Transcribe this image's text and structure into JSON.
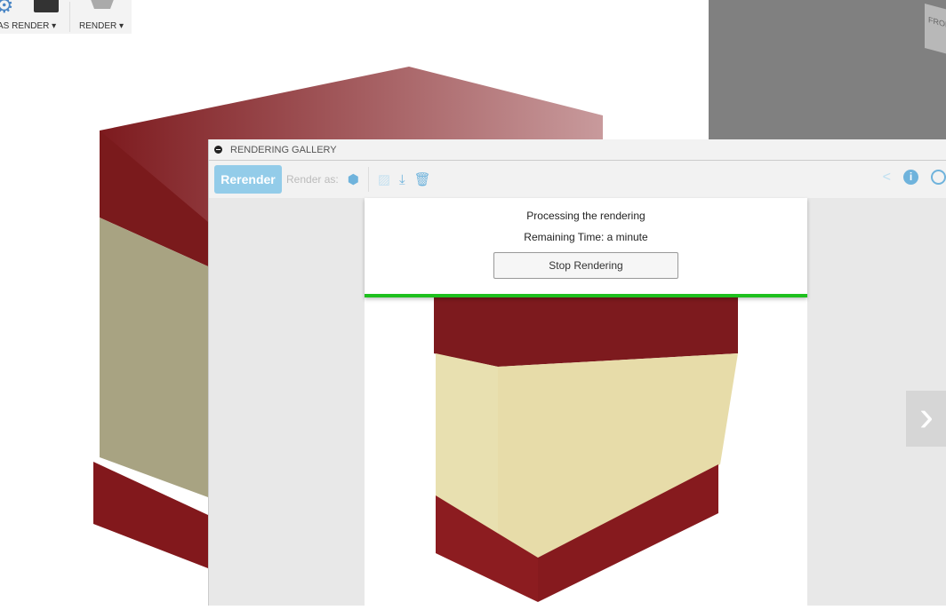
{
  "ribbon": {
    "items": [
      {
        "label": "AS RENDER ▾"
      },
      {
        "label": "RENDER ▾"
      }
    ]
  },
  "viewcube": {
    "face_label": "FRONT"
  },
  "gallery": {
    "title": "RENDERING GALLERY",
    "toolbar": {
      "rerender_label": "Rerender",
      "render_as_label": "Render as:"
    },
    "progress": {
      "status": "Processing the rendering",
      "remaining": "Remaining Time: a minute",
      "stop_label": "Stop Rendering",
      "percent": 100,
      "color": "#1ec01e"
    },
    "next_label": "›"
  },
  "colors": {
    "accent": "#93cce9",
    "hive_red": "#7d1a1e",
    "hive_body": "#e7dca9"
  }
}
